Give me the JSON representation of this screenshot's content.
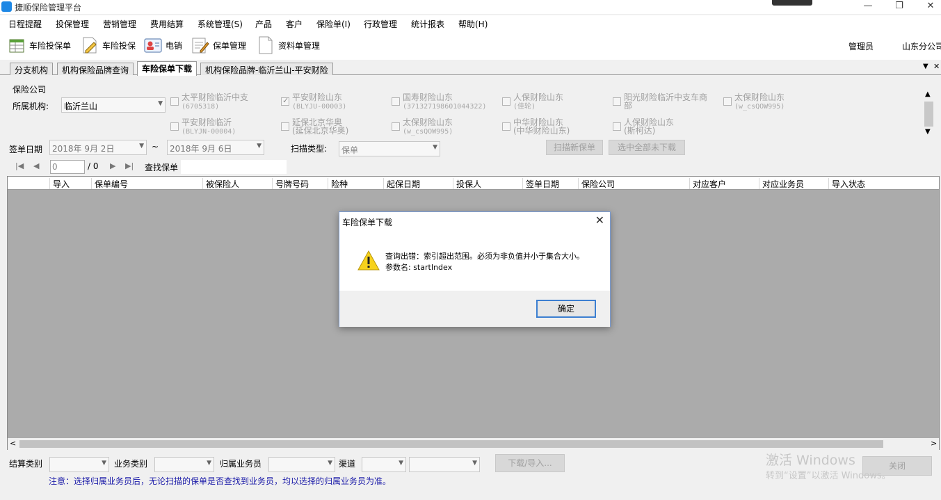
{
  "window": {
    "title": "捷顺保险管理平台",
    "minimize": "—",
    "restore": "❐",
    "close": "✕"
  },
  "menu": [
    "日程提醒",
    "投保管理",
    "营销管理",
    "费用结算",
    "系统管理(S)",
    "产品",
    "客户",
    "保险单(I)",
    "行政管理",
    "统计报表",
    "帮助(H)"
  ],
  "toolbar": {
    "buttons": [
      "车险投保单",
      "车险投保",
      "电销",
      "保单管理",
      "资料单管理"
    ],
    "user": "管理员",
    "branch": "山东分公司"
  },
  "tabs": [
    "分支机构",
    "机构保险品牌查询",
    "车险保单下载",
    "机构保险品牌-临沂兰山-平安财险"
  ],
  "tab_menu_arrow": "▼",
  "tab_close": "✕",
  "filters": {
    "group_label": "保险公司",
    "org_label": "所属机构:",
    "org_value": "临沂兰山",
    "companies": [
      {
        "name": "太平财险临沂中支",
        "code": "(6705318)",
        "checked": false
      },
      {
        "name": "平安财险山东",
        "code": "(BLYJU-00003)",
        "checked": true
      },
      {
        "name": "国寿财险山东",
        "code": "(371327198601044322)",
        "checked": false
      },
      {
        "name": "人保财险山东",
        "code": "(佳轮)",
        "checked": false
      },
      {
        "name": "阳光财险临沂中支车商",
        "code": "部",
        "checked": false
      },
      {
        "name": "太保财险山东",
        "code": "(w_csQOW995)",
        "checked": false
      },
      {
        "name": "平安财险临沂",
        "code": "(BLYJN-00004)",
        "checked": false
      },
      {
        "name": "延保北京华奥",
        "code": "(延保北京华奥)",
        "checked": false
      },
      {
        "name": "太保财险山东",
        "code": "(w_csQOW995)",
        "checked": false
      },
      {
        "name": "中华财险山东",
        "code": "(中华财险山东)",
        "checked": false
      },
      {
        "name": "人保财险山东",
        "code": "(斯柯达)",
        "checked": false
      }
    ],
    "date_label": "签单日期",
    "date_from": "2018年 9月 2日",
    "date_sep": "~",
    "date_to": "2018年 9月 6日",
    "scan_type_label": "扫描类型:",
    "scan_type_value": "保单",
    "scan_new_button": "扫描新保单",
    "select_all_button": "选中全部未下载"
  },
  "navigator": {
    "position": "0",
    "total": "/ 0",
    "find_label": "查找保单"
  },
  "grid": {
    "columns": [
      "导入",
      "保单编号",
      "被保险人",
      "号牌号码",
      "险种",
      "起保日期",
      "投保人",
      "签单日期",
      "保险公司",
      "对应客户",
      "对应业务员",
      "导入状态"
    ]
  },
  "footer": {
    "settle_label": "结算类别",
    "biz_label": "业务类别",
    "agent_label": "归属业务员",
    "channel_label": "渠道",
    "download_button": "下载/导入...",
    "close_button": "关闭",
    "note": "注意：选择归属业务员后，无论扫描的保单是否查找到业务员，均以选择的归属业务员为准。"
  },
  "watermark": {
    "line1": "激活 Windows",
    "line2": "转到“设置”以激活 Windows。"
  },
  "dialog": {
    "title": "车险保单下载",
    "message_line1": "查询出错：索引超出范围。必须为非负值并小于集合大小。",
    "message_line2": "参数名: startIndex",
    "ok_button": "确定"
  },
  "colors": {
    "accent": "#3c7fd1",
    "note": "#1a1aa8",
    "grid_bg": "#ababab"
  }
}
